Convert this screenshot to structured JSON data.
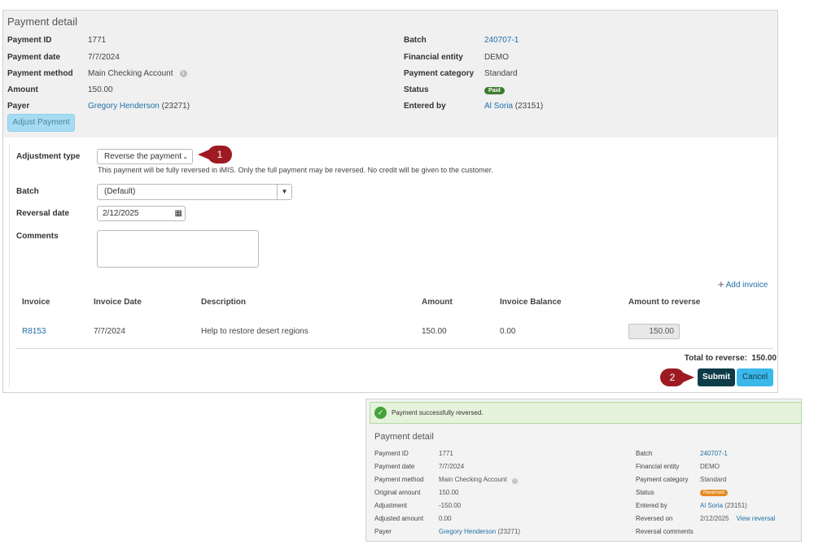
{
  "payment_detail": {
    "title": "Payment detail",
    "left": [
      {
        "label": "Payment ID",
        "value": "1771"
      },
      {
        "label": "Payment date",
        "value": "7/7/2024"
      },
      {
        "label": "Payment method",
        "value": "Main Checking Account"
      },
      {
        "label": "Amount",
        "value": "150.00"
      },
      {
        "label": "Payer",
        "value_link": "Gregory Henderson",
        "value_suffix": "(23271)"
      }
    ],
    "right": [
      {
        "label": "Batch",
        "value_link": "240707-1"
      },
      {
        "label": "Financial entity",
        "value": "DEMO"
      },
      {
        "label": "Payment category",
        "value": "Standard"
      },
      {
        "label": "Status",
        "badge": "Paid"
      },
      {
        "label": "Entered by",
        "value_link": "Al Soria",
        "value_suffix": "(23151)"
      }
    ],
    "adjust_button": "Adjust Payment"
  },
  "form": {
    "adjustment_type_label": "Adjustment type",
    "adjustment_type_value": "Reverse the payment",
    "adjustment_help": "This payment will be fully reversed in iMIS. Only the full payment may be reversed. No credit will be given to the customer.",
    "batch_label": "Batch",
    "batch_value": "(Default)",
    "reversal_date_label": "Reversal date",
    "reversal_date_value": "2/12/2025",
    "comments_label": "Comments",
    "add_invoice": "Add invoice",
    "callout_1": "1",
    "callout_2": "2"
  },
  "table": {
    "headers": [
      "Invoice",
      "Invoice Date",
      "Description",
      "Amount",
      "Invoice Balance",
      "Amount to reverse"
    ],
    "rows": [
      {
        "invoice": "R8153",
        "date": "7/7/2024",
        "description": "Help to restore desert regions",
        "amount": "150.00",
        "balance": "0.00",
        "to_reverse": "150.00"
      }
    ],
    "total_label": "Total to reverse:",
    "total_value": "150.00"
  },
  "actions": {
    "submit": "Submit",
    "cancel": "Cancel"
  },
  "result": {
    "success_message": "Payment successfully reversed.",
    "title": "Payment detail",
    "left": [
      {
        "label": "Payment ID",
        "value": "1771"
      },
      {
        "label": "Payment date",
        "value": "7/7/2024"
      },
      {
        "label": "Payment method",
        "value": "Main Checking Account"
      },
      {
        "label": "Original amount",
        "value": "150.00"
      },
      {
        "label": "Adjustment",
        "value": "-150.00"
      },
      {
        "label": "Adjusted amount",
        "value": "0.00"
      },
      {
        "label": "Payer",
        "value_link": "Gregory Henderson",
        "value_suffix": "(23271)"
      }
    ],
    "right": [
      {
        "label": "Batch",
        "value_link": "240707-1"
      },
      {
        "label": "Financial entity",
        "value": "DEMO"
      },
      {
        "label": "Payment category",
        "value": "Standard"
      },
      {
        "label": "Status",
        "badge": "Reversed"
      },
      {
        "label": "Entered by",
        "value_link": "Al Soria",
        "value_suffix": "(23151)"
      },
      {
        "label": "Reversed on",
        "value": "2/12/2025",
        "extra_link": "View reversal"
      },
      {
        "label": "Reversal comments",
        "value": ""
      }
    ]
  },
  "colors": {
    "link": "#1f6fa6",
    "paid_badge": "#3e7b2f",
    "reversed_badge": "#e38a1f",
    "callout": "#9e1a22",
    "submit": "#0d3b48",
    "cancel": "#3bb7ea"
  }
}
